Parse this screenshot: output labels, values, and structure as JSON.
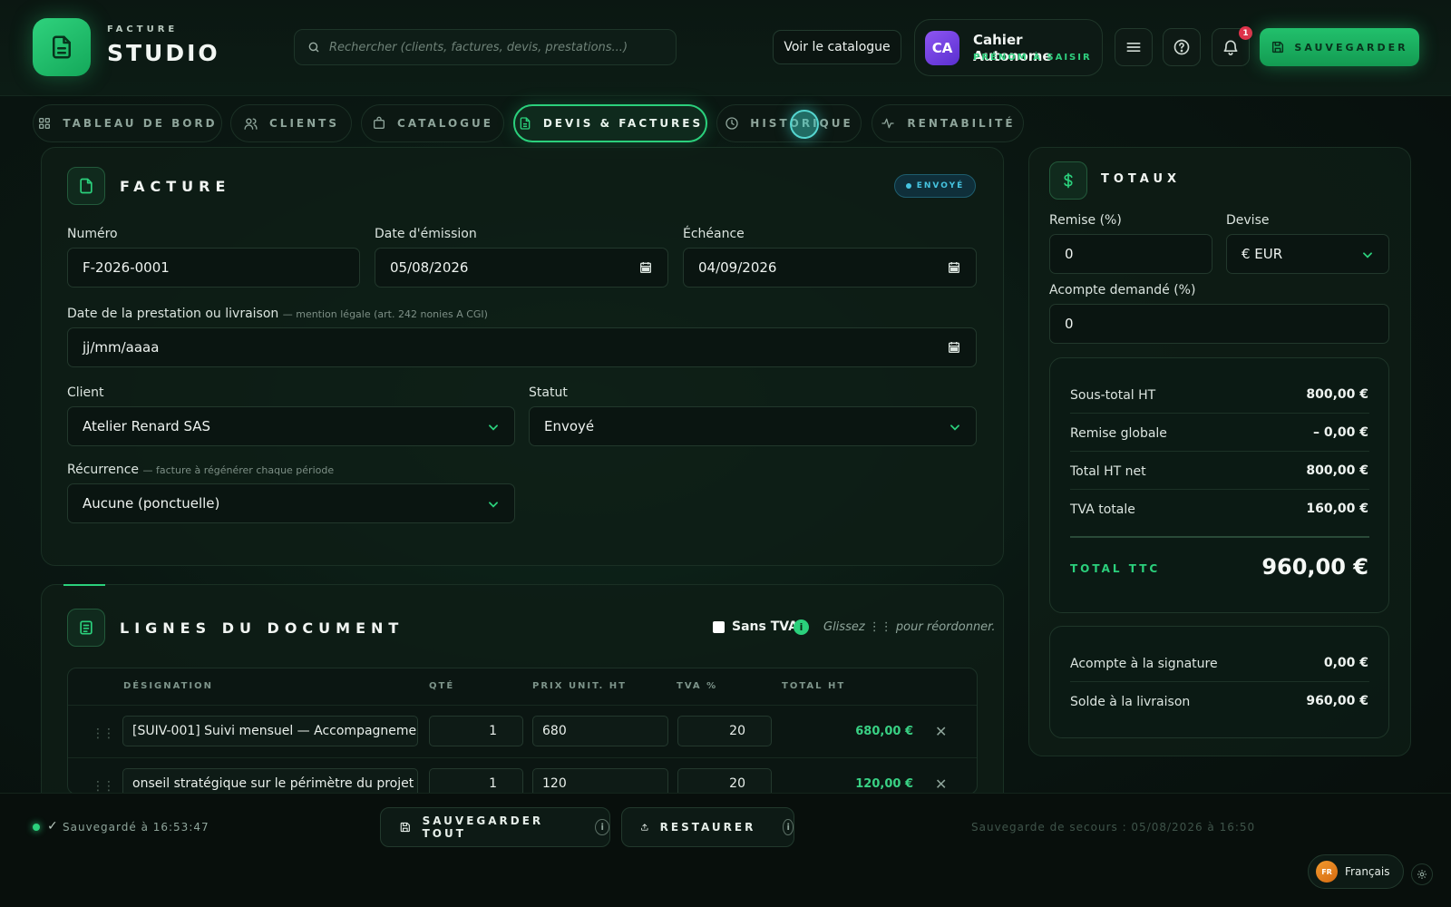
{
  "header": {
    "brand_small": "FACTURE",
    "brand_big": "STUDIO",
    "search_placeholder": "Rechercher (clients, factures, devis, prestations...)",
    "catalog_button": "Voir le catalogue",
    "profile": {
      "initials": "CA",
      "name": "Cahier Autonome",
      "subtitle": "PRÉNOM À SAISIR"
    },
    "notification_count": "1",
    "save_button": "SAUVEGARDER"
  },
  "nav": {
    "tabs": [
      {
        "label": "TABLEAU DE BORD",
        "icon": "grid-icon"
      },
      {
        "label": "CLIENTS",
        "icon": "users-icon"
      },
      {
        "label": "CATALOGUE",
        "icon": "bag-icon"
      },
      {
        "label": "DEVIS & FACTURES",
        "icon": "document-icon",
        "active": true
      },
      {
        "label": "HISTORIQUE",
        "icon": "clock-icon"
      },
      {
        "label": "RENTABILITÉ",
        "icon": "activity-icon"
      }
    ]
  },
  "invoice": {
    "title": "FACTURE",
    "status_badge": "ENVOYÉ",
    "numero_label": "Numéro",
    "numero_value": "F-2026-0001",
    "emission_label": "Date d'émission",
    "emission_value": "05/08/2026",
    "echeance_label": "Échéance",
    "echeance_value": "04/09/2026",
    "prestation_label": "Date de la prestation ou livraison",
    "prestation_hint": "— mention légale (art. 242 nonies A CGI)",
    "prestation_placeholder": "jj/mm/aaaa",
    "client_label": "Client",
    "client_value": "Atelier Renard SAS",
    "statut_label": "Statut",
    "statut_value": "Envoyé",
    "recurrence_label": "Récurrence",
    "recurrence_hint": "— facture à régénérer chaque période",
    "recurrence_value": "Aucune (ponctuelle)"
  },
  "lines": {
    "title": "LIGNES DU DOCUMENT",
    "sans_tva_label": "Sans TVA",
    "reorder_hint": "Glissez ⋮⋮ pour réordonner.",
    "columns": [
      "DÉSIGNATION",
      "QTÉ",
      "PRIX UNIT. HT",
      "TVA %",
      "TOTAL HT"
    ],
    "rows": [
      {
        "designation": "[SUIV-001] Suivi mensuel — Accompagneme",
        "qty": "1",
        "price": "680",
        "tva": "20",
        "total": "680,00 €"
      },
      {
        "designation": "onseil stratégique sur le périmètre du projet",
        "qty": "1",
        "price": "120",
        "tva": "20",
        "total": "120,00 €"
      }
    ]
  },
  "totals": {
    "title": "TOTAUX",
    "remise_label": "Remise (%)",
    "remise_value": "0",
    "devise_label": "Devise",
    "devise_value": "€ EUR",
    "acompte_label": "Acompte demandé (%)",
    "acompte_value": "0",
    "summary": [
      {
        "label": "Sous-total HT",
        "value": "800,00 €"
      },
      {
        "label": "Remise globale",
        "value": "– 0,00 €"
      },
      {
        "label": "Total HT net",
        "value": "800,00 €"
      },
      {
        "label": "TVA totale",
        "value": "160,00 €"
      }
    ],
    "ttc_label": "TOTAL TTC",
    "ttc_value": "960,00 €",
    "acompte_signature_label": "Acompte à la signature",
    "acompte_signature_value": "0,00 €",
    "solde_label": "Solde à la livraison",
    "solde_value": "960,00 €"
  },
  "footer": {
    "saved_status": "Sauvegardé à 16:53:47",
    "save_all": "SAUVEGARDER TOUT",
    "restore": "RESTAURER",
    "backup_text": "Sauvegarde de secours : 05/08/2026 à 16:50",
    "language": "Français",
    "language_code": "FR"
  },
  "colors": {
    "accent": "#22c06c",
    "status_sent": "#46c4e0",
    "badge": "#e0324b",
    "background": "#0a1712"
  }
}
